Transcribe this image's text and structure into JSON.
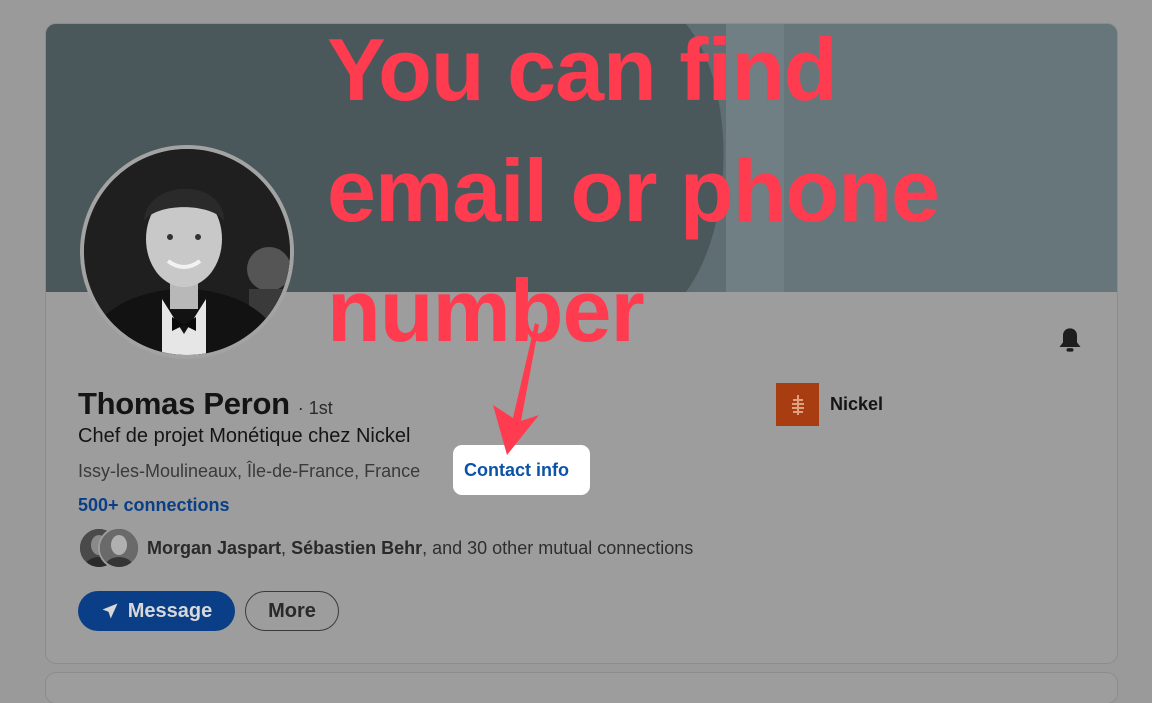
{
  "profile": {
    "name": "Thomas Peron",
    "degree": "· 1st",
    "headline": "Chef de projet Monétique chez Nickel",
    "location": "Issy-les-Moulineaux, Île-de-France, France",
    "separator": "·",
    "contact_info": "Contact info",
    "connections": "500+ connections"
  },
  "mutual": {
    "name1": "Morgan Jaspart",
    "comma": ", ",
    "name2": "Sébastien Behr",
    "rest": ", and 30 other mutual connections"
  },
  "actions": {
    "message_label": "Message",
    "more_label": "More"
  },
  "company": {
    "name": "Nickel"
  },
  "annotation": {
    "line1": "You can find",
    "line2": "email or phone",
    "line3": "number"
  },
  "icons": {
    "bell": "bell-icon",
    "send": "send-icon",
    "company_logo": "nickel-logo-icon"
  },
  "colors": {
    "annotation": "#ff3b50",
    "link": "#0b52a8",
    "primary_button": "#0a3f88",
    "company_logo": "#a83d12"
  }
}
